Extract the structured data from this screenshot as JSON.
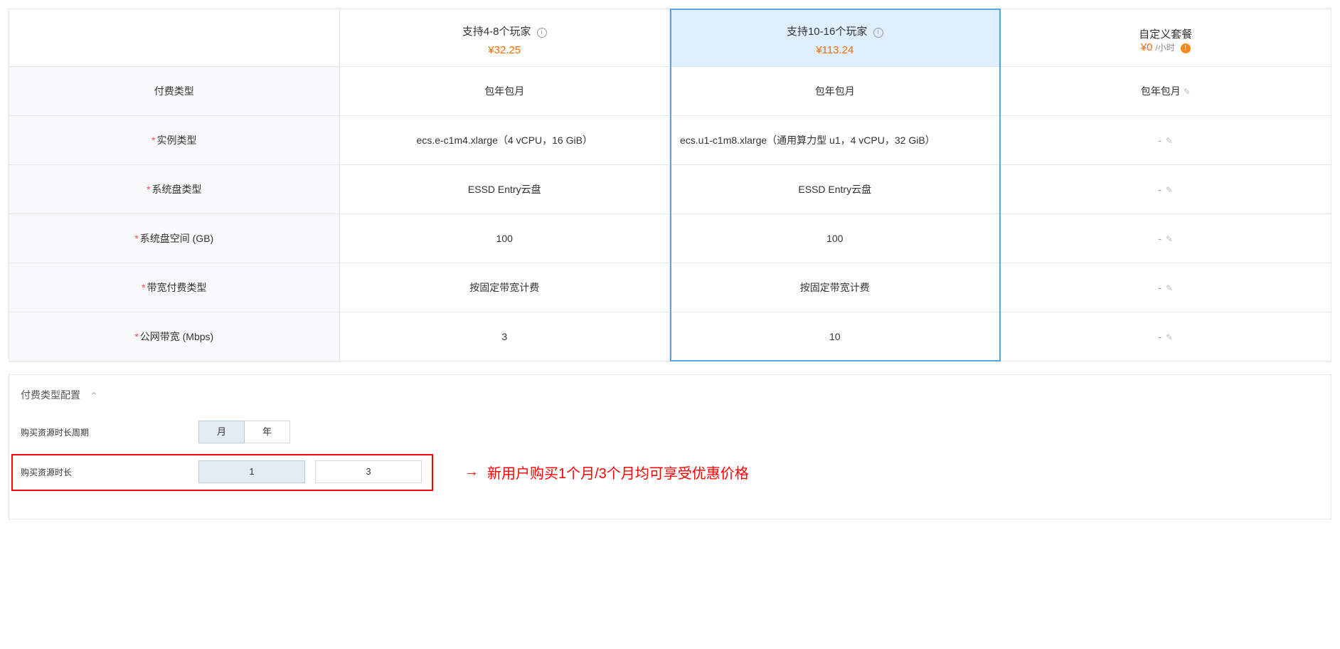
{
  "plans": {
    "p1": {
      "title": "支持4-8个玩家",
      "price": "¥32.25"
    },
    "p2": {
      "title": "支持10-16个玩家",
      "price": "¥113.24"
    },
    "p3": {
      "title": "自定义套餐",
      "price": "¥0",
      "unit": "/小时"
    }
  },
  "rows": {
    "pay_type": {
      "label": "付费类型",
      "p1": "包年包月",
      "p2": "包年包月",
      "p3": "包年包月"
    },
    "instance": {
      "label": "实例类型",
      "p1": "ecs.e-c1m4.xlarge（4 vCPU，16 GiB）",
      "p2": "ecs.u1-c1m8.xlarge（通用算力型 u1，4 vCPU，32 GiB）",
      "p3": "-"
    },
    "disk_type": {
      "label": "系统盘类型",
      "p1": "ESSD Entry云盘",
      "p2": "ESSD Entry云盘",
      "p3": "-"
    },
    "disk_size": {
      "label": "系统盘空间 (GB)",
      "p1": "100",
      "p2": "100",
      "p3": "-"
    },
    "bw_pay": {
      "label": "带宽付费类型",
      "p1": "按固定带宽计费",
      "p2": "按固定带宽计费",
      "p3": "-"
    },
    "bw": {
      "label": "公网带宽 (Mbps)",
      "p1": "3",
      "p2": "10",
      "p3": "-"
    }
  },
  "config_section_title": "付费类型配置",
  "period_label": "购买资源时长周期",
  "duration_label": "购买资源时长",
  "period_options": {
    "month": "月",
    "year": "年"
  },
  "duration_options": {
    "d1": "1",
    "d3": "3"
  },
  "annotation": "新用户购买1个月/3个月均可享受优惠价格"
}
